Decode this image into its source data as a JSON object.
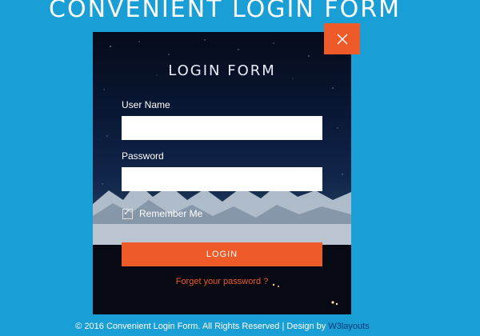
{
  "page": {
    "title": "CONVENIENT LOGIN FORM"
  },
  "form": {
    "title": "LOGIN FORM",
    "username_label": "User Name",
    "username_value": "",
    "password_label": "Password",
    "password_value": "",
    "remember_label": "Remember Me",
    "remember_checked": true,
    "check_mark": "✓",
    "login_label": "LOGIN",
    "forgot_label": "Forget your password ?"
  },
  "close": {
    "icon": "close-icon"
  },
  "footer": {
    "text": "© 2016 Convenient Login Form. All Rights Reserved | Design by ",
    "link": "W3layouts"
  },
  "colors": {
    "background": "#1a9ed6",
    "accent": "#ef5a29",
    "card_dark": "#0a1836",
    "text_light": "#ffffff",
    "footer_link": "#0d3a7a"
  }
}
